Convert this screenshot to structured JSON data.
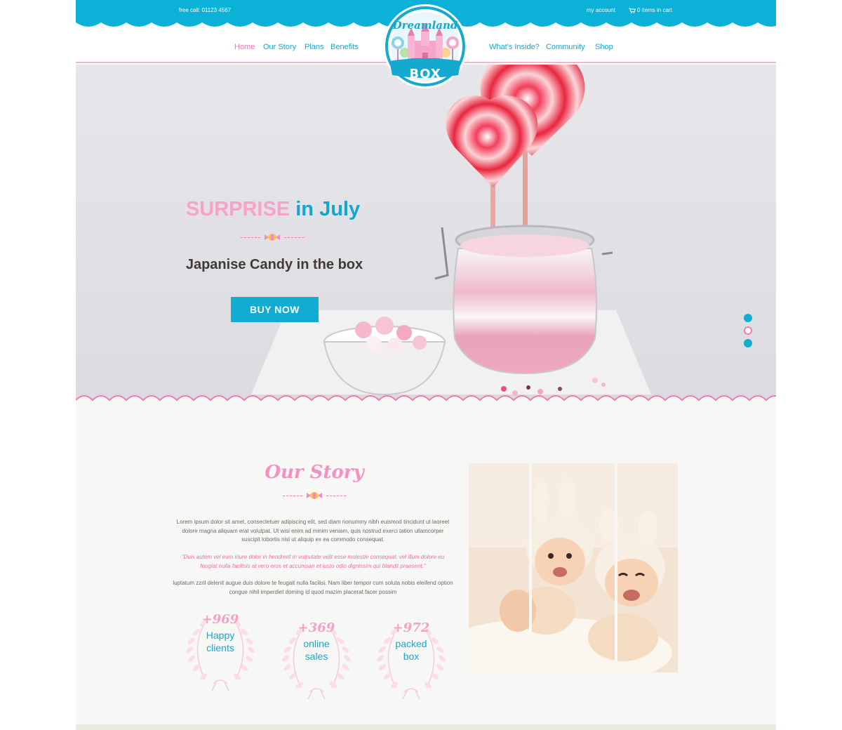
{
  "topbar": {
    "phone": "free call:  01123 4567",
    "account": "my account",
    "cart": "0 items in cart"
  },
  "logo": {
    "top_text": "Dreamland",
    "bottom_text": "BOX"
  },
  "nav": {
    "left": [
      "Home",
      "Our Story",
      "Plans",
      "Benefits"
    ],
    "right": [
      "What's Inside?",
      "Community",
      "Shop"
    ],
    "active": "Home"
  },
  "hero": {
    "title_highlight": "SURPRISE",
    "title_rest": "in July",
    "subtitle": "Japanise Candy in the box",
    "button": "BUY NOW",
    "slides": 3,
    "active_slide": 2
  },
  "story": {
    "title": "Our Story",
    "paragraph1": "Lorem ipsum dolor sit amet, consectetuer adipiscing elit, sed diam nonummy nibh euismod tincidunt ut laoreet dolore magna aliquam erat volutpat. Ut wisi enim ad minim veniam, quis nostrud exerci tation ullamcorper suscipit lobortis nisl ut aliquip ex ea commodo consequat.",
    "paragraph2": "\"Duis autem vel eum iriure dolor in hendrerit in vulputate velit esse molestie consequat, vel illum dolore eu feugiat nulla facilisis at vero eros et accumsan et iusto odio dignissim qui blandit praesent.\"",
    "paragraph3": "luptatum zzril delenit augue duis dolore te feugait nulla facilisi. Nam liber tempor cum soluta nobis eleifend option congue nihil imperdiet doming id quod mazim placerat facer possim",
    "stats": [
      {
        "number": "+969",
        "label": "Happy\nclients"
      },
      {
        "number": "+369",
        "label": "online\nsales"
      },
      {
        "number": "+972",
        "label": "packed\nbox"
      }
    ]
  },
  "colors": {
    "primary": "#0cb1d7",
    "pink": "#f392c0",
    "text": "#3f3a37"
  },
  "icons": [
    "cart-icon",
    "candy-icon",
    "wreath-icon"
  ]
}
